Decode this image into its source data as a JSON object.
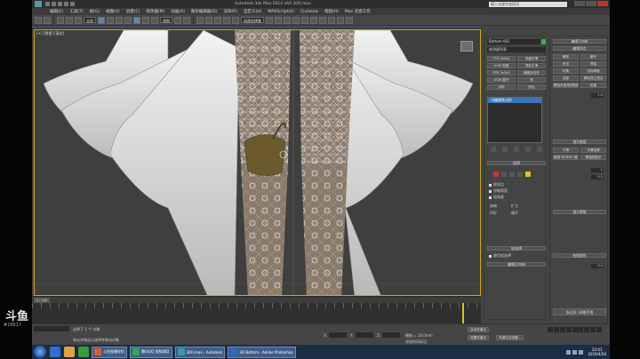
{
  "watermark": {
    "logo": "斗鱼",
    "room": "#16617"
  },
  "app": {
    "title": "Autodesk 3ds Max 2014 x64    3D0.max",
    "help_search": "键入关键字或短语",
    "menus": [
      "编辑(E)",
      "工具(T)",
      "组(G)",
      "视图(V)",
      "创建(C)",
      "修改器(M)",
      "动画(A)",
      "图形编辑器(D)",
      "渲染(R)",
      "自定义(U)",
      "MAXScript(X)",
      "Civilview",
      "帮助(H)",
      "Max 灵感工作"
    ],
    "toolbar": {
      "selection_filter": "全部",
      "ref_coord": "视图",
      "selection_set": "创建选择集"
    }
  },
  "viewport": {
    "label": "[+] [透视] [真实]"
  },
  "command_panel": {
    "object_name": "Bottom 001",
    "modifier_list": "修改器列表",
    "modifier_buttons": [
      "FFD 4x4x4",
      "网格平滑",
      "UVW 贴图",
      "涡轮平滑",
      "FFD 3x3x3",
      "编辑多边形",
      "UVW 展开",
      "壳",
      "对称",
      "挤出"
    ],
    "stack_item": "可编辑多边形",
    "rollout_selection": "选择",
    "rollout_soft": "软选择",
    "rollout_edit": "编辑几何体",
    "checks": [
      "按顶点",
      "忽略背面",
      "按角度",
      "收缩",
      "扩大",
      "环形",
      "循环"
    ],
    "soft_sel_label": "使用软选择"
  },
  "edit_panel": {
    "header1": "编辑几何体",
    "header2": "编辑顶点",
    "buttons_a": [
      "移除",
      "断开",
      "挤出",
      "焊接",
      "切角",
      "目标焊接",
      "连接",
      "移除孤立顶点",
      "移除未使用的贴图顶点",
      "权重"
    ],
    "header3": "细分曲面",
    "buttons_b": [
      "平滑",
      "平滑结果",
      "使用 NURMS 细分",
      "等值线显示"
    ],
    "header4": "细分置换",
    "header5": "绘制变形",
    "numbers": [
      "1",
      "0.0",
      "1.0",
      "0.5"
    ],
    "bottom_btn": "多边形: 网格平滑"
  },
  "timeline": {
    "frame_label": "0 / 100"
  },
  "status": {
    "selection": "选择了 1 个 对象",
    "prompt": "单击并拖动以选择并移动对象",
    "x": "X:",
    "y": "Y:",
    "z": "Z:",
    "grid": "栅格 = 10.0mm",
    "add_time_tag": "添加时间标记",
    "auto_key": "自动关键点",
    "set_key": "设置关键点",
    "key_filters": "关键点过滤器..."
  },
  "taskbar": {
    "tasks": [
      {
        "label": "斗鱼直播伴侣",
        "color": "#e35b2a"
      },
      {
        "label": "腾讯QQ 视频通话",
        "color": "#2fa84f"
      },
      {
        "label": "3D0.max - Autodesk",
        "color": "#3a9aa8"
      },
      {
        "label": "3D Bottom - Adobe Photoshop",
        "color": "#2b6ac2"
      }
    ],
    "clock_time": "22:01",
    "clock_date": "2016/4/26"
  }
}
